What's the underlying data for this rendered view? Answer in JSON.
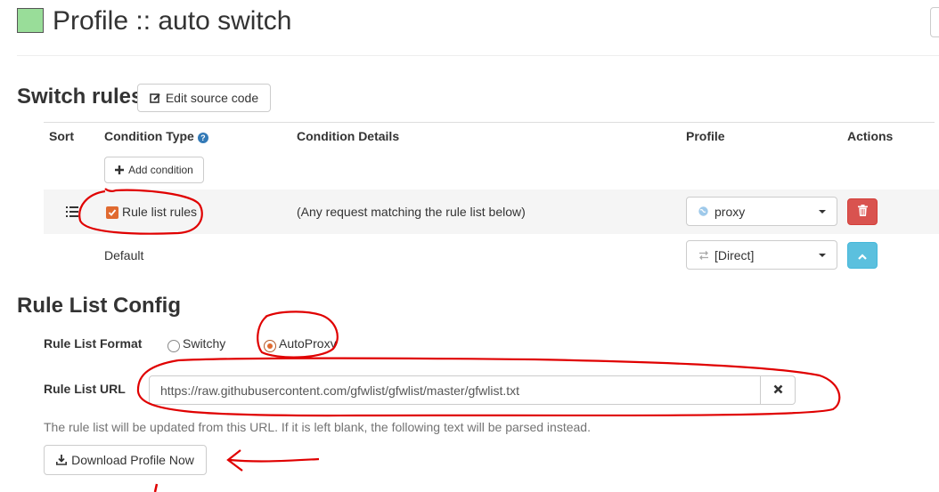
{
  "header": {
    "title": "Profile :: auto switch",
    "profile_color": "#99dd99"
  },
  "switch_rules": {
    "title": "Switch rules",
    "edit_source_label": "Edit source code",
    "columns": {
      "sort": "Sort",
      "condition_type": "Condition Type",
      "condition_details": "Condition Details",
      "profile": "Profile",
      "actions": "Actions"
    },
    "add_condition_label": "Add condition",
    "rows": [
      {
        "condition_type": "Rule list rules",
        "condition_details": "(Any request matching the rule list below)",
        "profile": "proxy"
      }
    ],
    "default_row": {
      "label": "Default",
      "profile": "[Direct]"
    }
  },
  "rule_list_config": {
    "title": "Rule List Config",
    "format_label": "Rule List Format",
    "format_options": [
      "Switchy",
      "AutoProxy"
    ],
    "format_selected": "AutoProxy",
    "url_label": "Rule List URL",
    "url_value": "https://raw.githubusercontent.com/gfwlist/gfwlist/master/gfwlist.txt",
    "help_text": "The rule list will be updated from this URL. If it is left blank, the following text will be parsed instead.",
    "download_label": "Download Profile Now"
  },
  "colors": {
    "danger": "#d9534f",
    "info": "#5bc0de",
    "link": "#337ab7",
    "annotation": "#e00000",
    "checkbox": "#e06a30"
  }
}
